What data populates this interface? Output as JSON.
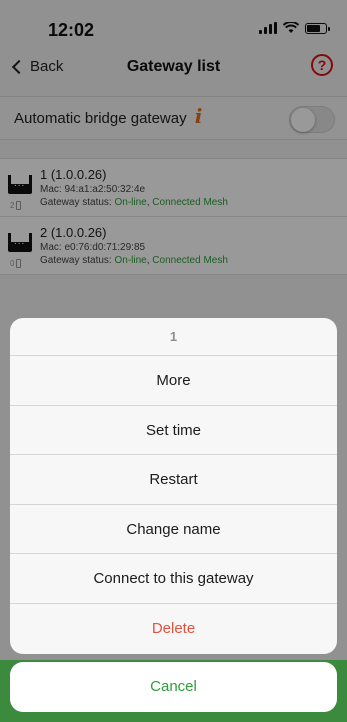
{
  "status_bar": {
    "time": "12:02"
  },
  "nav": {
    "back_label": "Back",
    "title": "Gateway list",
    "help_symbol": "?"
  },
  "auto_bridge": {
    "label": "Automatic bridge gateway",
    "info_symbol": "i",
    "enabled": false
  },
  "gateways": [
    {
      "name": "1 (1.0.0.26)",
      "mac": "Mac: 94:a1:a2:50:32:4e",
      "status_prefix": "Gateway status: ",
      "status_online": "On-line",
      "status_sep": ", ",
      "status_mesh": "Connected Mesh",
      "count": "2"
    },
    {
      "name": "2 (1.0.0.26)",
      "mac": "Mac: e0:76:d0:71:29:85",
      "status_prefix": "Gateway status: ",
      "status_online": "On-line",
      "status_sep": ", ",
      "status_mesh": "Connected Mesh",
      "count": "0"
    }
  ],
  "action_sheet": {
    "title": "1",
    "options": [
      "More",
      "Set time",
      "Restart",
      "Change name",
      "Connect to this gateway",
      "Delete"
    ],
    "cancel": "Cancel"
  },
  "colors": {
    "accent_green": "#2e9d3a",
    "danger": "#e2533f",
    "help_red": "#dd1111",
    "info_orange": "#e36b1a"
  }
}
